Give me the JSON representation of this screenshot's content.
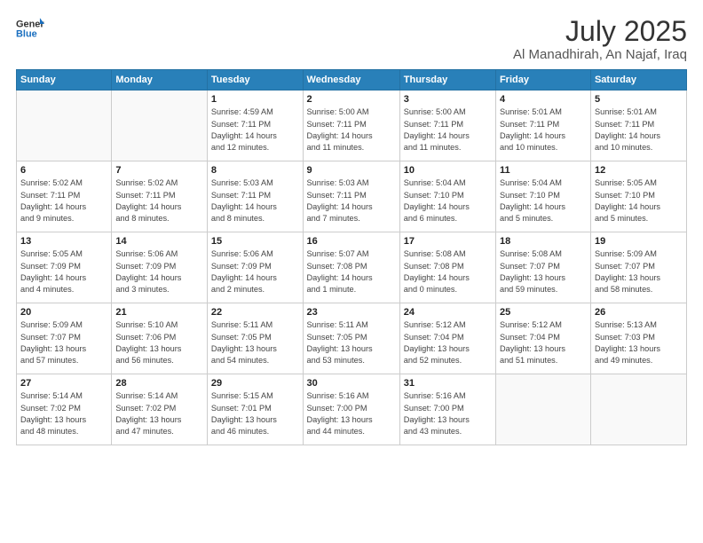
{
  "logo": {
    "line1": "General",
    "line2": "Blue"
  },
  "title": "July 2025",
  "location": "Al Manadhirah, An Najaf, Iraq",
  "weekdays": [
    "Sunday",
    "Monday",
    "Tuesday",
    "Wednesday",
    "Thursday",
    "Friday",
    "Saturday"
  ],
  "weeks": [
    [
      {
        "day": "",
        "info": ""
      },
      {
        "day": "",
        "info": ""
      },
      {
        "day": "1",
        "info": "Sunrise: 4:59 AM\nSunset: 7:11 PM\nDaylight: 14 hours\nand 12 minutes."
      },
      {
        "day": "2",
        "info": "Sunrise: 5:00 AM\nSunset: 7:11 PM\nDaylight: 14 hours\nand 11 minutes."
      },
      {
        "day": "3",
        "info": "Sunrise: 5:00 AM\nSunset: 7:11 PM\nDaylight: 14 hours\nand 11 minutes."
      },
      {
        "day": "4",
        "info": "Sunrise: 5:01 AM\nSunset: 7:11 PM\nDaylight: 14 hours\nand 10 minutes."
      },
      {
        "day": "5",
        "info": "Sunrise: 5:01 AM\nSunset: 7:11 PM\nDaylight: 14 hours\nand 10 minutes."
      }
    ],
    [
      {
        "day": "6",
        "info": "Sunrise: 5:02 AM\nSunset: 7:11 PM\nDaylight: 14 hours\nand 9 minutes."
      },
      {
        "day": "7",
        "info": "Sunrise: 5:02 AM\nSunset: 7:11 PM\nDaylight: 14 hours\nand 8 minutes."
      },
      {
        "day": "8",
        "info": "Sunrise: 5:03 AM\nSunset: 7:11 PM\nDaylight: 14 hours\nand 8 minutes."
      },
      {
        "day": "9",
        "info": "Sunrise: 5:03 AM\nSunset: 7:11 PM\nDaylight: 14 hours\nand 7 minutes."
      },
      {
        "day": "10",
        "info": "Sunrise: 5:04 AM\nSunset: 7:10 PM\nDaylight: 14 hours\nand 6 minutes."
      },
      {
        "day": "11",
        "info": "Sunrise: 5:04 AM\nSunset: 7:10 PM\nDaylight: 14 hours\nand 5 minutes."
      },
      {
        "day": "12",
        "info": "Sunrise: 5:05 AM\nSunset: 7:10 PM\nDaylight: 14 hours\nand 5 minutes."
      }
    ],
    [
      {
        "day": "13",
        "info": "Sunrise: 5:05 AM\nSunset: 7:09 PM\nDaylight: 14 hours\nand 4 minutes."
      },
      {
        "day": "14",
        "info": "Sunrise: 5:06 AM\nSunset: 7:09 PM\nDaylight: 14 hours\nand 3 minutes."
      },
      {
        "day": "15",
        "info": "Sunrise: 5:06 AM\nSunset: 7:09 PM\nDaylight: 14 hours\nand 2 minutes."
      },
      {
        "day": "16",
        "info": "Sunrise: 5:07 AM\nSunset: 7:08 PM\nDaylight: 14 hours\nand 1 minute."
      },
      {
        "day": "17",
        "info": "Sunrise: 5:08 AM\nSunset: 7:08 PM\nDaylight: 14 hours\nand 0 minutes."
      },
      {
        "day": "18",
        "info": "Sunrise: 5:08 AM\nSunset: 7:07 PM\nDaylight: 13 hours\nand 59 minutes."
      },
      {
        "day": "19",
        "info": "Sunrise: 5:09 AM\nSunset: 7:07 PM\nDaylight: 13 hours\nand 58 minutes."
      }
    ],
    [
      {
        "day": "20",
        "info": "Sunrise: 5:09 AM\nSunset: 7:07 PM\nDaylight: 13 hours\nand 57 minutes."
      },
      {
        "day": "21",
        "info": "Sunrise: 5:10 AM\nSunset: 7:06 PM\nDaylight: 13 hours\nand 56 minutes."
      },
      {
        "day": "22",
        "info": "Sunrise: 5:11 AM\nSunset: 7:05 PM\nDaylight: 13 hours\nand 54 minutes."
      },
      {
        "day": "23",
        "info": "Sunrise: 5:11 AM\nSunset: 7:05 PM\nDaylight: 13 hours\nand 53 minutes."
      },
      {
        "day": "24",
        "info": "Sunrise: 5:12 AM\nSunset: 7:04 PM\nDaylight: 13 hours\nand 52 minutes."
      },
      {
        "day": "25",
        "info": "Sunrise: 5:12 AM\nSunset: 7:04 PM\nDaylight: 13 hours\nand 51 minutes."
      },
      {
        "day": "26",
        "info": "Sunrise: 5:13 AM\nSunset: 7:03 PM\nDaylight: 13 hours\nand 49 minutes."
      }
    ],
    [
      {
        "day": "27",
        "info": "Sunrise: 5:14 AM\nSunset: 7:02 PM\nDaylight: 13 hours\nand 48 minutes."
      },
      {
        "day": "28",
        "info": "Sunrise: 5:14 AM\nSunset: 7:02 PM\nDaylight: 13 hours\nand 47 minutes."
      },
      {
        "day": "29",
        "info": "Sunrise: 5:15 AM\nSunset: 7:01 PM\nDaylight: 13 hours\nand 46 minutes."
      },
      {
        "day": "30",
        "info": "Sunrise: 5:16 AM\nSunset: 7:00 PM\nDaylight: 13 hours\nand 44 minutes."
      },
      {
        "day": "31",
        "info": "Sunrise: 5:16 AM\nSunset: 7:00 PM\nDaylight: 13 hours\nand 43 minutes."
      },
      {
        "day": "",
        "info": ""
      },
      {
        "day": "",
        "info": ""
      }
    ]
  ]
}
